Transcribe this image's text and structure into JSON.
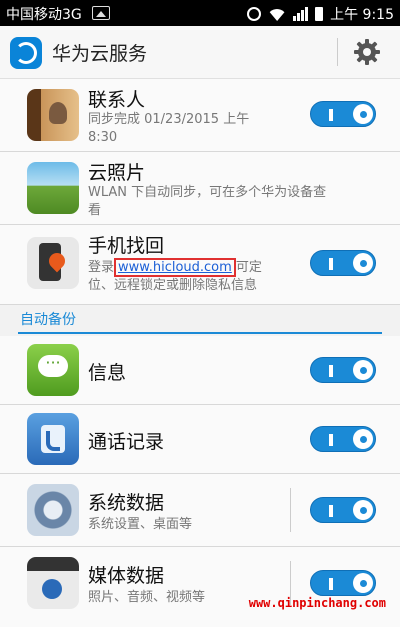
{
  "status_bar": {
    "carrier": "中国移动3G",
    "time": "上午 9:15"
  },
  "header": {
    "title": "华为云服务"
  },
  "sync_items": [
    {
      "title": "联系人",
      "subtitle_line1": "同步完成  01/23/2015 上午",
      "subtitle_line2": "8:30",
      "enabled": true
    },
    {
      "title": "云照片",
      "subtitle_line1": "WLAN 下自动同步，可在多个华为设备查",
      "subtitle_line2": "看"
    },
    {
      "title": "手机找回",
      "subtitle_prefix": "登录",
      "link_text": "www.hicloud.com",
      "subtitle_suffix": "可定",
      "subtitle_line2": "位、远程锁定或删除隐私信息",
      "enabled": true
    }
  ],
  "section": {
    "label": "自动备份"
  },
  "backup_items": [
    {
      "title": "信息",
      "enabled": true
    },
    {
      "title": "通话记录",
      "enabled": true
    },
    {
      "title": "系统数据",
      "subtitle": "系统设置、桌面等",
      "enabled": true
    },
    {
      "title": "媒体数据",
      "subtitle": "照片、音频、视频等",
      "enabled": true
    }
  ],
  "watermark": "www.qinpinchang.com",
  "colors": {
    "accent": "#1b8ad6",
    "highlight_box": "#e03030"
  }
}
